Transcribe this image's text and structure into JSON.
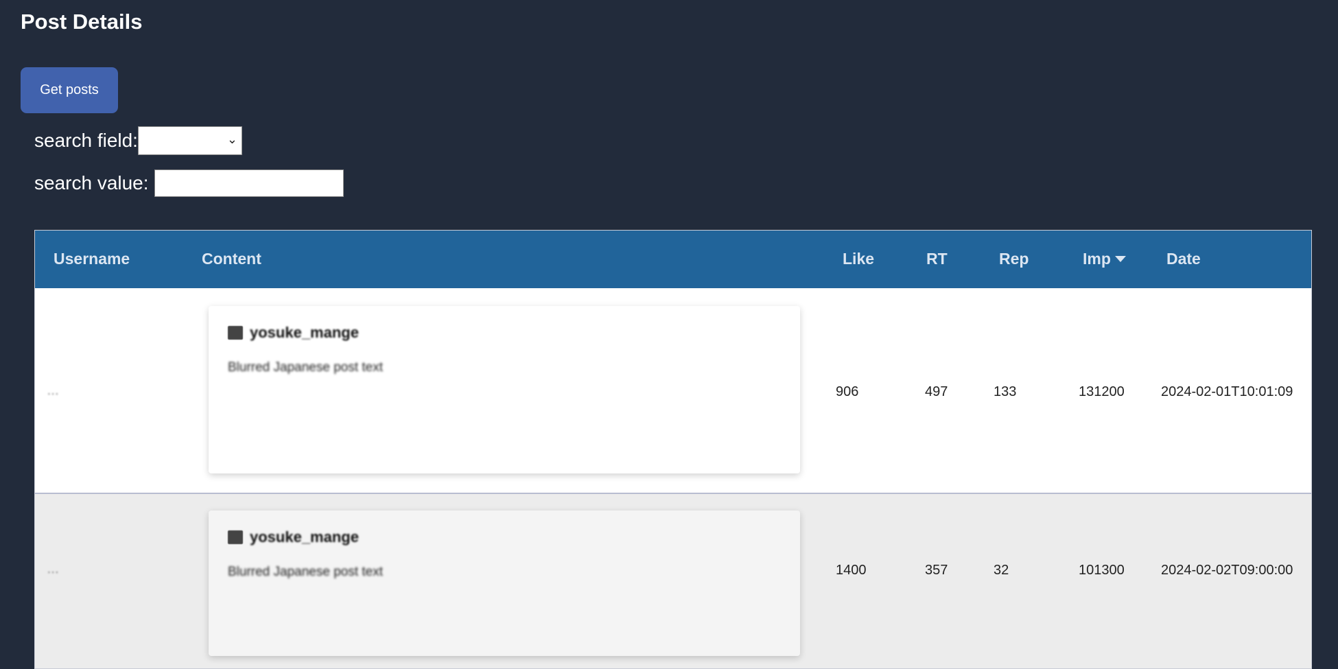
{
  "page": {
    "title": "Post Details"
  },
  "toolbar": {
    "get_posts_label": "Get posts"
  },
  "search": {
    "field_label": "search field:",
    "field_value": "",
    "value_label": "search value:",
    "value_input": ""
  },
  "table": {
    "headers": {
      "username": "Username",
      "content": "Content",
      "like": "Like",
      "rt": "RT",
      "rep": "Rep",
      "imp": "Imp",
      "date": "Date"
    },
    "sort": {
      "column": "Imp",
      "direction": "descending"
    },
    "rows": [
      {
        "username": "...",
        "card_handle": "yosuke_mange",
        "content": "Blurred Japanese post text",
        "like": "906",
        "rt": "497",
        "rep": "133",
        "imp": "131200",
        "date": "2024-02-01T10:01:09"
      },
      {
        "username": "...",
        "card_handle": "yosuke_mange",
        "content": "Blurred Japanese post text",
        "like": "1400",
        "rt": "357",
        "rep": "32",
        "imp": "101300",
        "date": "2024-02-02T09:00:00"
      }
    ]
  },
  "colors": {
    "background": "#222b3b",
    "button": "#4162ad",
    "table_header": "#21649a",
    "row_alt": "#ececec"
  }
}
